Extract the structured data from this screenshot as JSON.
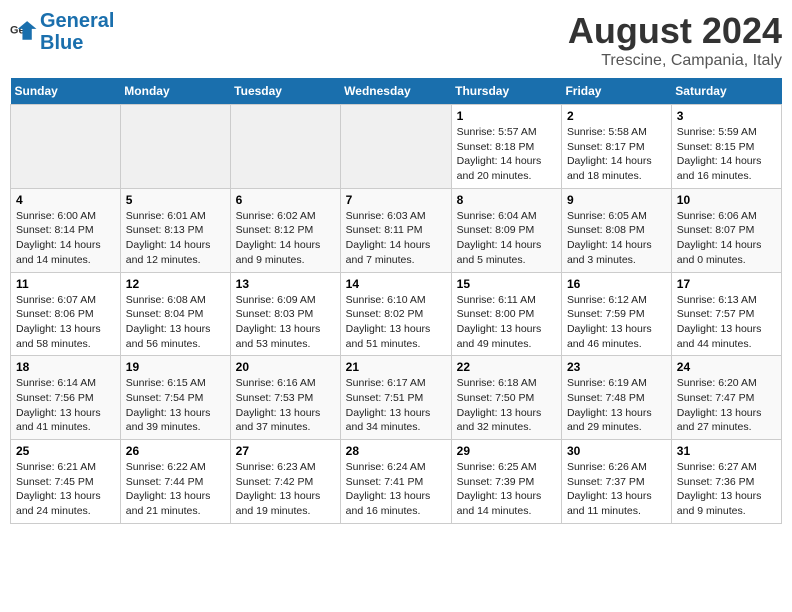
{
  "logo": {
    "text_general": "General",
    "text_blue": "Blue"
  },
  "title": "August 2024",
  "subtitle": "Trescine, Campania, Italy",
  "days_of_week": [
    "Sunday",
    "Monday",
    "Tuesday",
    "Wednesday",
    "Thursday",
    "Friday",
    "Saturday"
  ],
  "weeks": [
    [
      {
        "day": "",
        "empty": true
      },
      {
        "day": "",
        "empty": true
      },
      {
        "day": "",
        "empty": true
      },
      {
        "day": "",
        "empty": true
      },
      {
        "day": "1",
        "sunrise": "5:57 AM",
        "sunset": "8:18 PM",
        "daylight": "14 hours and 20 minutes."
      },
      {
        "day": "2",
        "sunrise": "5:58 AM",
        "sunset": "8:17 PM",
        "daylight": "14 hours and 18 minutes."
      },
      {
        "day": "3",
        "sunrise": "5:59 AM",
        "sunset": "8:15 PM",
        "daylight": "14 hours and 16 minutes."
      }
    ],
    [
      {
        "day": "4",
        "sunrise": "6:00 AM",
        "sunset": "8:14 PM",
        "daylight": "14 hours and 14 minutes."
      },
      {
        "day": "5",
        "sunrise": "6:01 AM",
        "sunset": "8:13 PM",
        "daylight": "14 hours and 12 minutes."
      },
      {
        "day": "6",
        "sunrise": "6:02 AM",
        "sunset": "8:12 PM",
        "daylight": "14 hours and 9 minutes."
      },
      {
        "day": "7",
        "sunrise": "6:03 AM",
        "sunset": "8:11 PM",
        "daylight": "14 hours and 7 minutes."
      },
      {
        "day": "8",
        "sunrise": "6:04 AM",
        "sunset": "8:09 PM",
        "daylight": "14 hours and 5 minutes."
      },
      {
        "day": "9",
        "sunrise": "6:05 AM",
        "sunset": "8:08 PM",
        "daylight": "14 hours and 3 minutes."
      },
      {
        "day": "10",
        "sunrise": "6:06 AM",
        "sunset": "8:07 PM",
        "daylight": "14 hours and 0 minutes."
      }
    ],
    [
      {
        "day": "11",
        "sunrise": "6:07 AM",
        "sunset": "8:06 PM",
        "daylight": "13 hours and 58 minutes."
      },
      {
        "day": "12",
        "sunrise": "6:08 AM",
        "sunset": "8:04 PM",
        "daylight": "13 hours and 56 minutes."
      },
      {
        "day": "13",
        "sunrise": "6:09 AM",
        "sunset": "8:03 PM",
        "daylight": "13 hours and 53 minutes."
      },
      {
        "day": "14",
        "sunrise": "6:10 AM",
        "sunset": "8:02 PM",
        "daylight": "13 hours and 51 minutes."
      },
      {
        "day": "15",
        "sunrise": "6:11 AM",
        "sunset": "8:00 PM",
        "daylight": "13 hours and 49 minutes."
      },
      {
        "day": "16",
        "sunrise": "6:12 AM",
        "sunset": "7:59 PM",
        "daylight": "13 hours and 46 minutes."
      },
      {
        "day": "17",
        "sunrise": "6:13 AM",
        "sunset": "7:57 PM",
        "daylight": "13 hours and 44 minutes."
      }
    ],
    [
      {
        "day": "18",
        "sunrise": "6:14 AM",
        "sunset": "7:56 PM",
        "daylight": "13 hours and 41 minutes."
      },
      {
        "day": "19",
        "sunrise": "6:15 AM",
        "sunset": "7:54 PM",
        "daylight": "13 hours and 39 minutes."
      },
      {
        "day": "20",
        "sunrise": "6:16 AM",
        "sunset": "7:53 PM",
        "daylight": "13 hours and 37 minutes."
      },
      {
        "day": "21",
        "sunrise": "6:17 AM",
        "sunset": "7:51 PM",
        "daylight": "13 hours and 34 minutes."
      },
      {
        "day": "22",
        "sunrise": "6:18 AM",
        "sunset": "7:50 PM",
        "daylight": "13 hours and 32 minutes."
      },
      {
        "day": "23",
        "sunrise": "6:19 AM",
        "sunset": "7:48 PM",
        "daylight": "13 hours and 29 minutes."
      },
      {
        "day": "24",
        "sunrise": "6:20 AM",
        "sunset": "7:47 PM",
        "daylight": "13 hours and 27 minutes."
      }
    ],
    [
      {
        "day": "25",
        "sunrise": "6:21 AM",
        "sunset": "7:45 PM",
        "daylight": "13 hours and 24 minutes."
      },
      {
        "day": "26",
        "sunrise": "6:22 AM",
        "sunset": "7:44 PM",
        "daylight": "13 hours and 21 minutes."
      },
      {
        "day": "27",
        "sunrise": "6:23 AM",
        "sunset": "7:42 PM",
        "daylight": "13 hours and 19 minutes."
      },
      {
        "day": "28",
        "sunrise": "6:24 AM",
        "sunset": "7:41 PM",
        "daylight": "13 hours and 16 minutes."
      },
      {
        "day": "29",
        "sunrise": "6:25 AM",
        "sunset": "7:39 PM",
        "daylight": "13 hours and 14 minutes."
      },
      {
        "day": "30",
        "sunrise": "6:26 AM",
        "sunset": "7:37 PM",
        "daylight": "13 hours and 11 minutes."
      },
      {
        "day": "31",
        "sunrise": "6:27 AM",
        "sunset": "7:36 PM",
        "daylight": "13 hours and 9 minutes."
      }
    ]
  ]
}
